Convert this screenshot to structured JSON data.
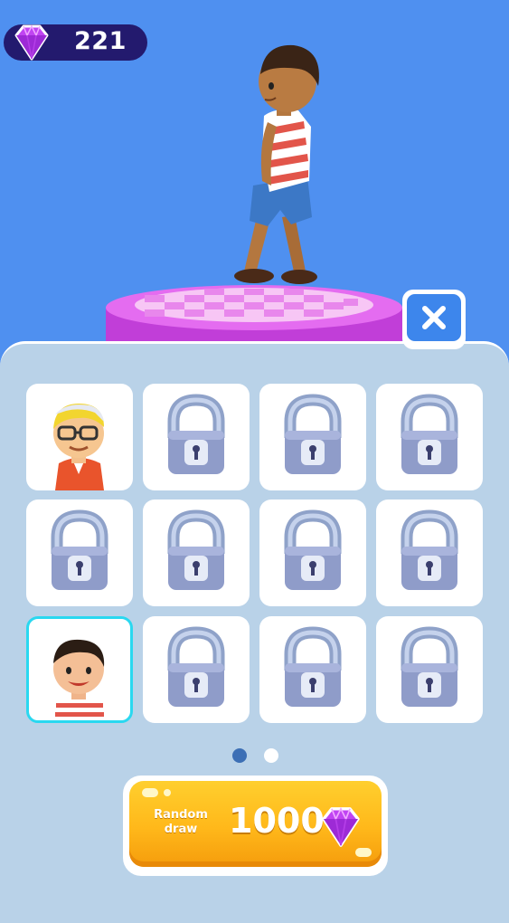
{
  "hud": {
    "gem_count": "221",
    "gem_icon": "purple-diamond-icon"
  },
  "close_icon": "close-icon",
  "grid": {
    "pages": 2,
    "current_page": 1,
    "tiles": [
      {
        "state": "unlocked",
        "character": "boy-with-glasses-cap"
      },
      {
        "state": "locked"
      },
      {
        "state": "locked"
      },
      {
        "state": "locked"
      },
      {
        "state": "locked"
      },
      {
        "state": "locked"
      },
      {
        "state": "locked"
      },
      {
        "state": "locked"
      },
      {
        "state": "unlocked-selected",
        "character": "boy-striped-shirt"
      },
      {
        "state": "locked"
      },
      {
        "state": "locked"
      },
      {
        "state": "locked"
      }
    ]
  },
  "draw_button": {
    "label": "Random draw",
    "price": "1000"
  },
  "colors": {
    "background": "#4f90f0",
    "panel": "#b9d2e8",
    "gem": "#b63bf0",
    "button": "#ffb81a",
    "selected_border": "#2ad8f0",
    "lock": "#8f9cc9"
  }
}
